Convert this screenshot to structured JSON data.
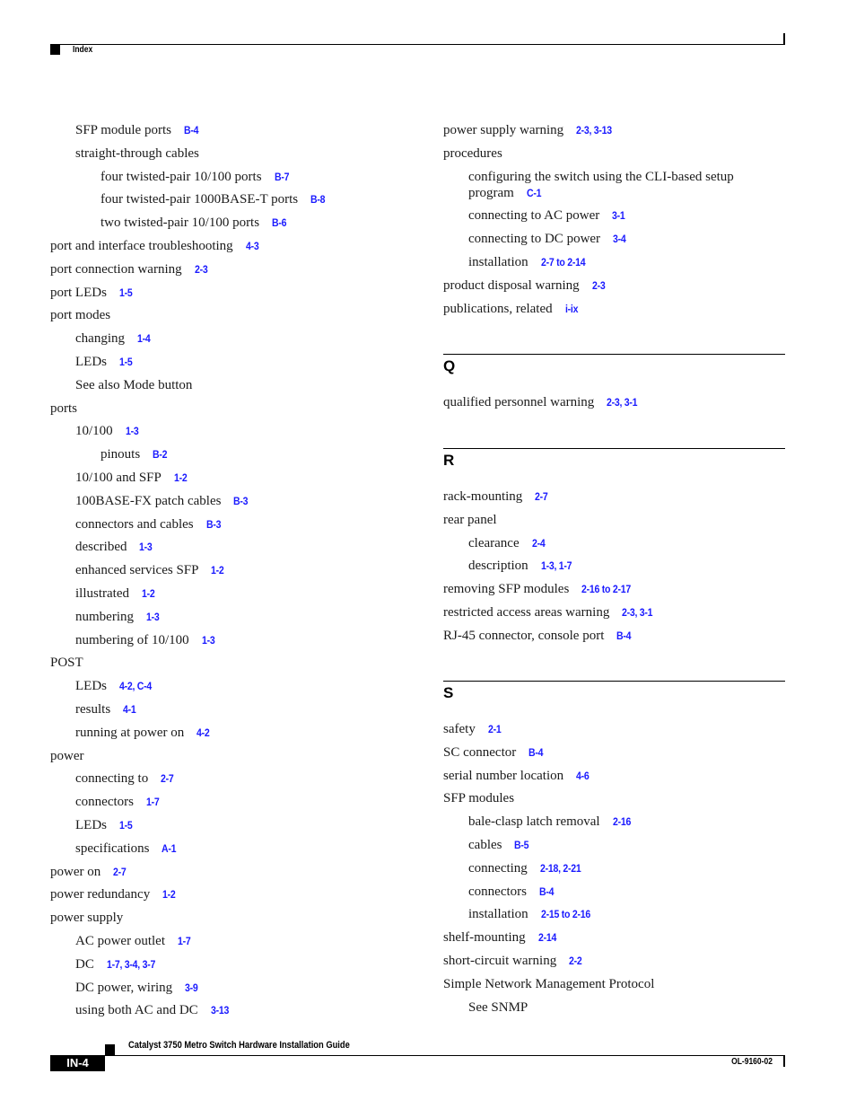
{
  "header": {
    "section_label": "Index"
  },
  "left_column": [
    {
      "text": "SFP module ports",
      "refs": "B-4",
      "level": 1
    },
    {
      "text": "straight-through cables",
      "refs": "",
      "level": 1
    },
    {
      "text": "four twisted-pair 10/100 ports",
      "refs": "B-7",
      "level": 2
    },
    {
      "text": "four twisted-pair 1000BASE-T ports",
      "refs": "B-8",
      "level": 2
    },
    {
      "text": "two twisted-pair 10/100 ports",
      "refs": "B-6",
      "level": 2
    },
    {
      "text": "port and interface troubleshooting",
      "refs": "4-3",
      "level": 0
    },
    {
      "text": "port connection warning",
      "refs": "2-3",
      "level": 0
    },
    {
      "text": "port LEDs",
      "refs": "1-5",
      "level": 0
    },
    {
      "text": "port modes",
      "refs": "",
      "level": 0
    },
    {
      "text": "changing",
      "refs": "1-4",
      "level": 1
    },
    {
      "text": "LEDs",
      "refs": "1-5",
      "level": 1
    },
    {
      "text": "See also Mode button",
      "refs": "",
      "level": 1
    },
    {
      "text": "ports",
      "refs": "",
      "level": 0
    },
    {
      "text": "10/100",
      "refs": "1-3",
      "level": 1
    },
    {
      "text": "pinouts",
      "refs": "B-2",
      "level": 2
    },
    {
      "text": "10/100 and SFP",
      "refs": "1-2",
      "level": 1
    },
    {
      "text": "100BASE-FX patch cables",
      "refs": "B-3",
      "level": 1
    },
    {
      "text": "connectors and cables",
      "refs": "B-3",
      "level": 1
    },
    {
      "text": "described",
      "refs": "1-3",
      "level": 1
    },
    {
      "text": "enhanced services SFP",
      "refs": "1-2",
      "level": 1
    },
    {
      "text": "illustrated",
      "refs": "1-2",
      "level": 1
    },
    {
      "text": "numbering",
      "refs": "1-3",
      "level": 1
    },
    {
      "text": "numbering of 10/100",
      "refs": "1-3",
      "level": 1
    },
    {
      "text": "POST",
      "refs": "",
      "level": 0
    },
    {
      "text": "LEDs",
      "refs": "4-2, C-4",
      "level": 1
    },
    {
      "text": "results",
      "refs": "4-1",
      "level": 1
    },
    {
      "text": "running at power on",
      "refs": "4-2",
      "level": 1
    },
    {
      "text": "power",
      "refs": "",
      "level": 0
    },
    {
      "text": "connecting to",
      "refs": "2-7",
      "level": 1
    },
    {
      "text": "connectors",
      "refs": "1-7",
      "level": 1
    },
    {
      "text": "LEDs",
      "refs": "1-5",
      "level": 1
    },
    {
      "text": "specifications",
      "refs": "A-1",
      "level": 1
    },
    {
      "text": "power on",
      "refs": "2-7",
      "level": 0
    },
    {
      "text": "power redundancy",
      "refs": "1-2",
      "level": 0
    },
    {
      "text": "power supply",
      "refs": "",
      "level": 0
    },
    {
      "text": "AC power outlet",
      "refs": "1-7",
      "level": 1
    },
    {
      "text": "DC",
      "refs": "1-7, 3-4, 3-7",
      "level": 1
    },
    {
      "text": "DC power, wiring",
      "refs": "3-9",
      "level": 1
    },
    {
      "text": "using both AC and DC",
      "refs": "3-13",
      "level": 1
    }
  ],
  "right_column": {
    "continued": [
      {
        "text": "power supply warning",
        "refs": "2-3, 3-13",
        "level": 0
      },
      {
        "text": "procedures",
        "refs": "",
        "level": 0
      },
      {
        "text": "configuring the switch using the CLI-based setup",
        "text2": "program",
        "refs": "C-1",
        "level": 1
      },
      {
        "text": "connecting to AC power",
        "refs": "3-1",
        "level": 1
      },
      {
        "text": "connecting to DC power",
        "refs": "3-4",
        "level": 1
      },
      {
        "text": "installation",
        "refs": "2-7 to 2-14",
        "level": 1
      },
      {
        "text": "product disposal warning",
        "refs": "2-3",
        "level": 0
      },
      {
        "text": "publications, related",
        "refs": "i-ix",
        "level": 0
      }
    ],
    "sections": [
      {
        "letter": "Q",
        "entries": [
          {
            "text": "qualified personnel warning",
            "refs": "2-3, 3-1",
            "level": 0
          }
        ]
      },
      {
        "letter": "R",
        "entries": [
          {
            "text": "rack-mounting",
            "refs": "2-7",
            "level": 0
          },
          {
            "text": "rear panel",
            "refs": "",
            "level": 0
          },
          {
            "text": "clearance",
            "refs": "2-4",
            "level": 1
          },
          {
            "text": "description",
            "refs": "1-3, 1-7",
            "level": 1
          },
          {
            "text": "removing SFP modules",
            "refs": "2-16 to 2-17",
            "level": 0
          },
          {
            "text": "restricted access areas warning",
            "refs": "2-3, 3-1",
            "level": 0
          },
          {
            "text": "RJ-45 connector, console port",
            "refs": "B-4",
            "level": 0
          }
        ]
      },
      {
        "letter": "S",
        "entries": [
          {
            "text": "safety",
            "refs": "2-1",
            "level": 0
          },
          {
            "text": "SC connector",
            "refs": "B-4",
            "level": 0
          },
          {
            "text": "serial number location",
            "refs": "4-6",
            "level": 0
          },
          {
            "text": "SFP modules",
            "refs": "",
            "level": 0
          },
          {
            "text": "bale-clasp latch removal",
            "refs": "2-16",
            "level": 1
          },
          {
            "text": "cables",
            "refs": "B-5",
            "level": 1
          },
          {
            "text": "connecting",
            "refs": "2-18, 2-21",
            "level": 1
          },
          {
            "text": "connectors",
            "refs": "B-4",
            "level": 1
          },
          {
            "text": "installation",
            "refs": "2-15 to 2-16",
            "level": 1
          },
          {
            "text": "shelf-mounting",
            "refs": "2-14",
            "level": 0
          },
          {
            "text": "short-circuit warning",
            "refs": "2-2",
            "level": 0
          },
          {
            "text": "Simple Network Management Protocol",
            "refs": "",
            "level": 0
          },
          {
            "text": "See SNMP",
            "refs": "",
            "level": 1
          }
        ]
      }
    ]
  },
  "footer": {
    "guide_title": "Catalyst 3750 Metro Switch Hardware Installation Guide",
    "page_number": "IN-4",
    "doc_number": "OL-9160-02"
  },
  "colors": {
    "link": "#1a1aff",
    "text": "#1a1a1a",
    "rule": "#000000"
  }
}
